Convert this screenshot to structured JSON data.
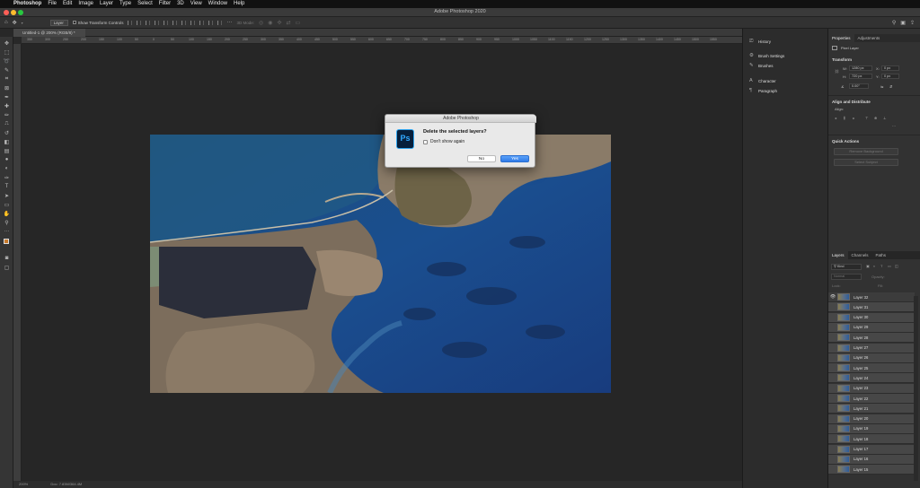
{
  "menubar": {
    "app_name": "Photoshop",
    "items": [
      "File",
      "Edit",
      "Image",
      "Layer",
      "Type",
      "Select",
      "Filter",
      "3D",
      "View",
      "Window",
      "Help"
    ]
  },
  "window": {
    "title": "Adobe Photoshop 2020",
    "traffic_colors": {
      "close": "#ff5f57",
      "min": "#febc2e",
      "max": "#28c840"
    }
  },
  "options_bar": {
    "auto_select_value": "Layer",
    "show_transform_label": "Show Transform Controls",
    "mode_label": "3D Mode:"
  },
  "document": {
    "tab_title": "Untitled-1 @ 200% (RGB/8) *",
    "zoom": "200%",
    "doc_info": "Doc: 7.83M/364.4M"
  },
  "ruler_ticks": [
    "350",
    "300",
    "250",
    "200",
    "150",
    "100",
    "50",
    "0",
    "50",
    "100",
    "150",
    "200",
    "250",
    "300",
    "350",
    "400",
    "450",
    "500",
    "550",
    "600",
    "650",
    "700",
    "750",
    "800",
    "850",
    "900",
    "950",
    "1000",
    "1050",
    "1100",
    "1150",
    "1200",
    "1250",
    "1300",
    "1350",
    "1400",
    "1450",
    "1500",
    "1550"
  ],
  "dock": {
    "items": [
      "History",
      "Brush Settings",
      "Brushes",
      "Character",
      "Paragraph"
    ]
  },
  "properties": {
    "tabs": [
      "Properties",
      "Adjustments"
    ],
    "pixel_layer_label": "Pixel Layer",
    "transform_label": "Transform",
    "w": "1280 px",
    "h": "720 px",
    "x": "0 px",
    "y": "0 px",
    "angle": "0.00°",
    "align_label": "Align and Distribute",
    "align_sub": "Align:",
    "quick_label": "Quick Actions",
    "remove_bg": "Remove Background",
    "select_subject": "Select Subject"
  },
  "layers": {
    "tabs": [
      "Layers",
      "Channels",
      "Paths"
    ],
    "kind_label": "Kind",
    "normal_label": "Normal",
    "opacity_label": "Opacity:",
    "fill_label": "Fill:",
    "lock_label": "Lock:",
    "items": [
      "Layer 32",
      "Layer 31",
      "Layer 30",
      "Layer 29",
      "Layer 28",
      "Layer 27",
      "Layer 26",
      "Layer 25",
      "Layer 24",
      "Layer 23",
      "Layer 22",
      "Layer 21",
      "Layer 20",
      "Layer 19",
      "Layer 18",
      "Layer 17",
      "Layer 16",
      "Layer 15"
    ]
  },
  "dialog": {
    "title": "Adobe Photoshop",
    "icon_text": "Ps",
    "message": "Delete the selected layers?",
    "checkbox_label": "Don't show again",
    "no_label": "No",
    "yes_label": "Yes"
  },
  "colors": {
    "accent": "#2f7be8",
    "ps_icon_blue": "#31a8ff",
    "ps_icon_bg": "#071f3b"
  }
}
